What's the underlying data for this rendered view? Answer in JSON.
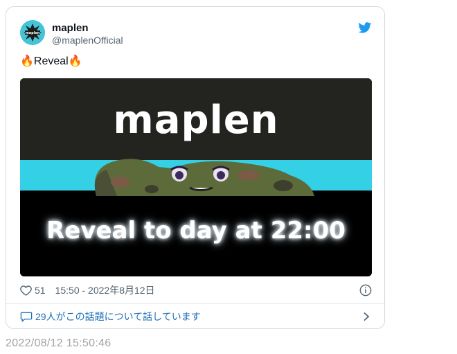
{
  "tweet": {
    "author_name": "maplen",
    "author_handle": "@maplenOfficial",
    "avatar_text": "maplen",
    "text": "Reveal",
    "emoji": "🔥",
    "likes": "51",
    "datetime": "15:50 - 2022年8月12日",
    "conversation": "29人がこの話題について話しています"
  },
  "media": {
    "title": "maplen",
    "subtitle": "Reveal to day at 22:00"
  },
  "footer": {
    "timestamp": "2022/08/12 15:50:46"
  },
  "colors": {
    "brand_blue": "#1d9bf0",
    "link_blue": "#1d6fb8",
    "stripe_cyan": "#33d0e6"
  }
}
